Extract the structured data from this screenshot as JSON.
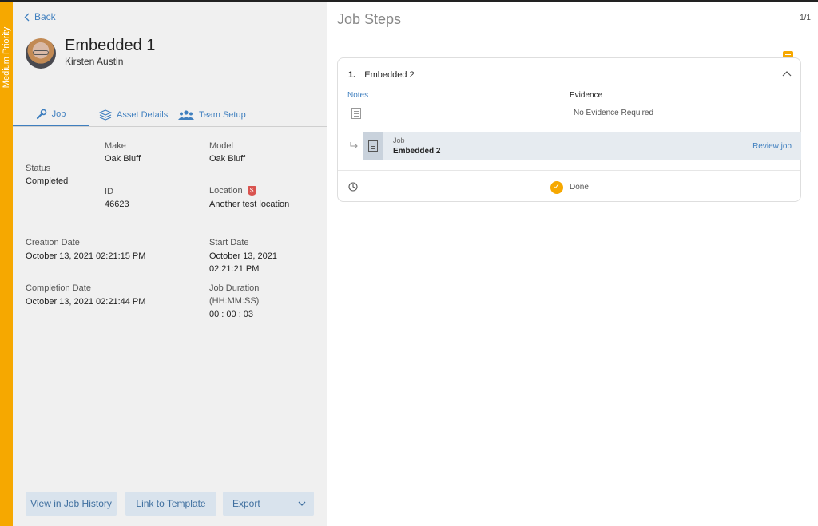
{
  "priority_label": "Medium Priority",
  "back_label": "Back",
  "job": {
    "title": "Embedded 1",
    "assignee": "Kirsten Austin"
  },
  "tabs": [
    {
      "label": "Job"
    },
    {
      "label": "Asset Details"
    },
    {
      "label": "Team Setup"
    }
  ],
  "details": {
    "make_label": "Make",
    "make_value": "Oak Bluff",
    "model_label": "Model",
    "model_value": "Oak Bluff",
    "status_label": "Status",
    "status_value": "Completed",
    "id_label": "ID",
    "id_value": "46623",
    "location_label": "Location",
    "location_badge": "$",
    "location_value": "Another test location",
    "creation_label": "Creation Date",
    "creation_value": "October 13, 2021 02:21:15 PM",
    "start_label": "Start Date",
    "start_value_line1": "October 13, 2021",
    "start_value_line2": "02:21:21 PM",
    "completion_label": "Completion Date",
    "completion_value": "October 13, 2021 02:21:44 PM",
    "duration_label_line1": "Job Duration",
    "duration_label_line2": "(HH:MM:SS)",
    "duration_value": "00 : 00 : 03"
  },
  "buttons": {
    "history": "View in Job History",
    "template": "Link to Template",
    "export": "Export"
  },
  "steps": {
    "title": "Job Steps",
    "pager": "1/1",
    "step": {
      "number": "1.",
      "name": "Embedded 2",
      "notes_label": "Notes",
      "evidence_label": "Evidence",
      "evidence_value": "No Evidence Required",
      "job_label": "Job",
      "job_name": "Embedded 2",
      "review_label": "Review job",
      "status": "Done"
    }
  },
  "colors": {
    "priority": "#f6a800",
    "link": "#3f7fbf",
    "button_bg": "#d9e3ed"
  }
}
